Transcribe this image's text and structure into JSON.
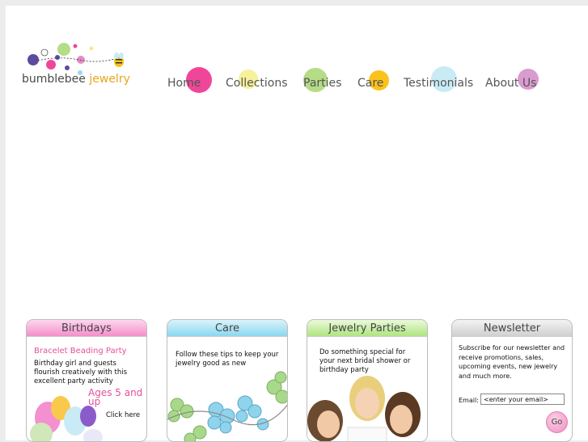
{
  "brand": {
    "name_part1": "bumblebee",
    "name_part2": "jewelry"
  },
  "nav": [
    {
      "label": "Home",
      "dot_color": "#f0469a"
    },
    {
      "label": "Collections",
      "dot_color": "#f6f19a"
    },
    {
      "label": "Parties",
      "dot_color": "#b5dc86"
    },
    {
      "label": "Care",
      "dot_color": "#fbc21c"
    },
    {
      "label": "Testimonials",
      "dot_color": "#c9ebf6"
    },
    {
      "label": "About Us",
      "dot_color": "#d99bd0"
    }
  ],
  "panels": {
    "birthdays": {
      "title": "Birthdays",
      "subtitle": "Bracelet Beading Party",
      "text": "Birthday girl and guests flourish creatively with this excellent party activity",
      "ages": "Ages 5 and up",
      "link": "Click here"
    },
    "care": {
      "title": "Care",
      "text": "Follow these tips to keep your jewelry good as new"
    },
    "parties": {
      "title": "Jewelry Parties",
      "text": "Do something special for your next bridal shower or birthday party"
    },
    "newsletter": {
      "title": "Newsletter",
      "text": "Subscribe for our newsletter and receive promotions, sales, upcoming events, new jewelry and much more.",
      "email_label": "Email:",
      "email_value": "<enter your email>",
      "go_label": "Go"
    }
  },
  "colors": {
    "accent_pink": "#e3519b",
    "accent_gold": "#e8a51c"
  }
}
